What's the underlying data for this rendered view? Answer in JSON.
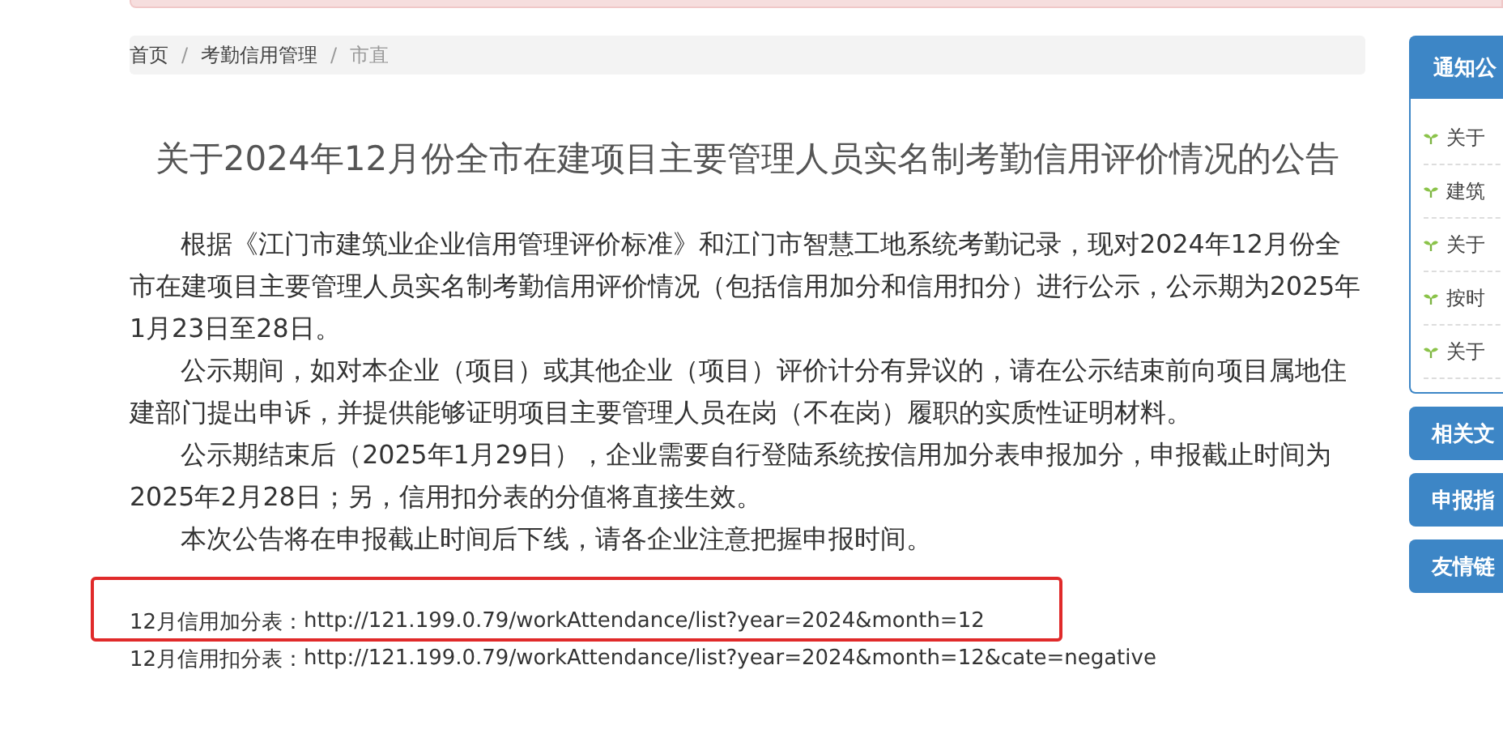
{
  "breadcrumb": [
    {
      "label": "首页",
      "selected": false
    },
    {
      "label": "考勤信用管理",
      "selected": false
    },
    {
      "label": "市直",
      "selected": true
    }
  ],
  "breadcrumb_separator": "/",
  "article": {
    "title": "关于2024年12月份全市在建项目主要管理人员实名制考勤信用评价情况的公告",
    "paragraphs": [
      "根据《江门市建筑业企业信用管理评价标准》和江门市智慧工地系统考勤记录，现对2024年12月份全市在建项目主要管理人员实名制考勤信用评价情况（包括信用加分和信用扣分）进行公示，公示期为2025年1月23日至28日。",
      "公示期间，如对本企业（项目）或其他企业（项目）评价计分有异议的，请在公示结束前向项目属地住建部门提出申诉，并提供能够证明项目主要管理人员在岗（不在岗）履职的实质性证明材料。",
      "公示期结束后（2025年1月29日），企业需要自行登陆系统按信用加分表申报加分，申报截止时间为2025年2月28日；另，信用扣分表的分值将直接生效。",
      "本次公告将在申报截止时间后下线，请各企业注意把握申报时间。"
    ],
    "links": [
      {
        "label": "12月信用加分表：",
        "url": "http://121.199.0.79/workAttendance/list?year=2024&month=12",
        "highlighted": true
      },
      {
        "label": "12月信用扣分表：",
        "url": "http://121.199.0.79/workAttendance/list?year=2024&month=12&cate=negative",
        "highlighted": false
      }
    ]
  },
  "sidebar": {
    "notice_panel": {
      "title": "通知公",
      "items": [
        "关于",
        "建筑",
        "关于",
        "按时",
        "关于"
      ]
    },
    "sections": [
      "相关文",
      "申报指",
      "友情链"
    ]
  }
}
